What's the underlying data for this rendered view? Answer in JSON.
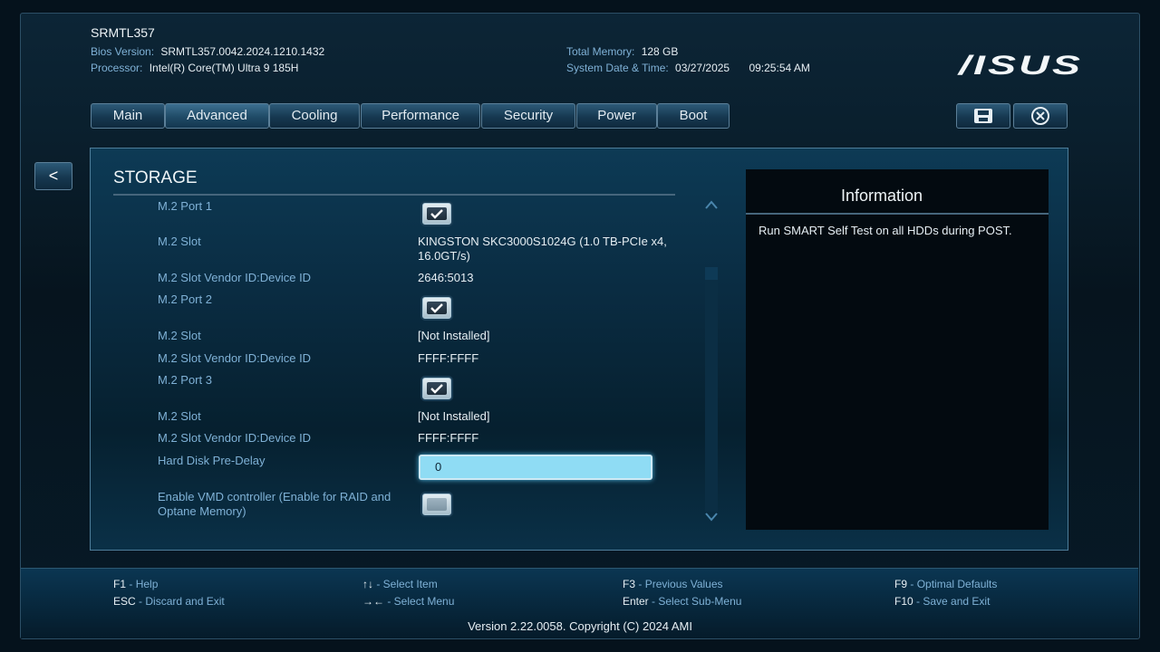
{
  "header": {
    "model": "SRMTL357",
    "bios_version_label": "Bios Version:",
    "bios_version": "SRMTL357.0042.2024.1210.1432",
    "processor_label": "Processor:",
    "processor": "Intel(R) Core(TM) Ultra 9 185H",
    "memory_label": "Total Memory:",
    "memory": "128 GB",
    "datetime_label": "System Date & Time:",
    "date": "03/27/2025",
    "time": "09:25:54 AM",
    "logo": "/ISUS"
  },
  "tabs": [
    {
      "label": "Main"
    },
    {
      "label": "Advanced",
      "active": true
    },
    {
      "label": "Cooling"
    },
    {
      "label": "Performance"
    },
    {
      "label": "Security"
    },
    {
      "label": "Power"
    },
    {
      "label": "Boot"
    }
  ],
  "toolbar": {
    "save_icon": "save-icon",
    "exit_icon": "close-circle-icon"
  },
  "back_label": "<",
  "section_title": "STORAGE",
  "rows": [
    {
      "label": "M.2 Port 1",
      "type": "checkbox",
      "checked": true
    },
    {
      "label": "M.2 Slot",
      "type": "text",
      "value": "KINGSTON SKC3000S1024G (1.0 TB-PCIe x4, 16.0GT/s)"
    },
    {
      "label": "M.2 Slot Vendor ID:Device ID",
      "type": "text",
      "value": "2646:5013"
    },
    {
      "label": "M.2 Port 2",
      "type": "checkbox",
      "checked": true
    },
    {
      "label": "M.2 Slot",
      "type": "text",
      "value": "[Not Installed]"
    },
    {
      "label": "M.2 Slot Vendor ID:Device ID",
      "type": "text",
      "value": "FFFF:FFFF"
    },
    {
      "label": "M.2 Port 3",
      "type": "checkbox",
      "checked": true
    },
    {
      "label": "M.2 Slot",
      "type": "text",
      "value": "[Not Installed]"
    },
    {
      "label": "M.2 Slot Vendor ID:Device ID",
      "type": "text",
      "value": "FFFF:FFFF"
    },
    {
      "label": "Hard Disk Pre-Delay",
      "type": "input",
      "value": "0"
    },
    {
      "label": "Enable VMD controller (Enable for RAID and Optane Memory)",
      "type": "checkbox",
      "checked": false
    }
  ],
  "info": {
    "title": "Information",
    "text": "Run SMART Self Test on all HDDs during POST."
  },
  "footer": {
    "keys": [
      {
        "key": "F1",
        "desc": "Help"
      },
      {
        "key": "ESC",
        "desc": "Discard and Exit"
      },
      {
        "key": "↑↓",
        "desc": "Select Item"
      },
      {
        "key": "→←",
        "desc": "Select Menu"
      },
      {
        "key": "F3",
        "desc": "Previous Values"
      },
      {
        "key": "Enter",
        "desc": "Select Sub-Menu"
      },
      {
        "key": "F9",
        "desc": "Optimal Defaults"
      },
      {
        "key": "F10",
        "desc": "Save and Exit"
      }
    ],
    "version": "Version 2.22.0058. Copyright (C) 2024 AMI"
  },
  "colors": {
    "accent": "#7fb1d6",
    "highlight": "#8fdcf4",
    "background": "#05121c"
  }
}
